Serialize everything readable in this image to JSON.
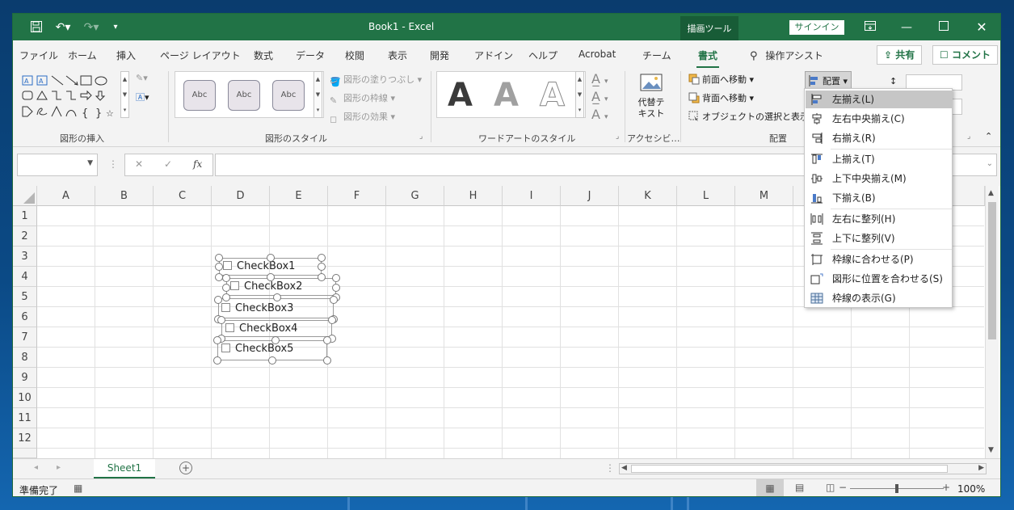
{
  "window": {
    "title": "Book1  -  Excel",
    "context_tool": "描画ツール",
    "signin": "サインイン"
  },
  "tabs": [
    {
      "label": "ファイル"
    },
    {
      "label": "ホーム"
    },
    {
      "label": "挿入"
    },
    {
      "label": "ページ レイアウト"
    },
    {
      "label": "数式"
    },
    {
      "label": "データ"
    },
    {
      "label": "校閲"
    },
    {
      "label": "表示"
    },
    {
      "label": "開発"
    },
    {
      "label": "アドイン"
    },
    {
      "label": "ヘルプ"
    },
    {
      "label": "Acrobat"
    },
    {
      "label": "チーム"
    },
    {
      "label": "書式"
    }
  ],
  "tell_me": "操作アシスト",
  "share_label": "共有",
  "comment_label": "コメント",
  "ribbon": {
    "groups": {
      "insert_shapes": "図形の挿入",
      "shape_styles": "図形のスタイル",
      "wordart_styles": "ワードアートのスタイル",
      "accessibility": "アクセシビ…",
      "arrange": "配置"
    },
    "style_preview_text": "Abc",
    "shape_fill": "図形の塗りつぶし",
    "shape_outline": "図形の枠線",
    "shape_effects": "図形の効果",
    "wordart_letter": "A",
    "alt_text": "代替テキスト",
    "bring_forward": "前面へ移動",
    "send_backward": "背面へ移動",
    "selection_pane": "オブジェクトの選択と表示",
    "align_button": "配置"
  },
  "formula_bar": {
    "name_box": "",
    "fx": "fx",
    "content": ""
  },
  "sheet": {
    "columns": [
      "A",
      "B",
      "C",
      "D",
      "E",
      "F",
      "G",
      "H",
      "I",
      "J",
      "K",
      "L",
      "M",
      "N"
    ],
    "rows": [
      "1",
      "2",
      "3",
      "4",
      "5",
      "6",
      "7",
      "8",
      "9",
      "10",
      "11",
      "12"
    ],
    "checkboxes": [
      "CheckBox1",
      "CheckBox2",
      "CheckBox3",
      "CheckBox4",
      "CheckBox5"
    ]
  },
  "sheet_tabs": [
    {
      "label": "Sheet1"
    }
  ],
  "status": {
    "ready": "準備完了",
    "zoom": "100%"
  },
  "align_menu": {
    "items": [
      {
        "label": "左揃え(L)",
        "icon": "align-left-icon",
        "highlighted": true
      },
      {
        "label": "左右中央揃え(C)",
        "icon": "align-center-icon"
      },
      {
        "label": "右揃え(R)",
        "icon": "align-right-icon"
      },
      {
        "label": "上揃え(T)",
        "icon": "align-top-icon"
      },
      {
        "label": "上下中央揃え(M)",
        "icon": "align-middle-icon"
      },
      {
        "label": "下揃え(B)",
        "icon": "align-bottom-icon"
      },
      {
        "label": "左右に整列(H)",
        "icon": "distribute-horizontal-icon"
      },
      {
        "label": "上下に整列(V)",
        "icon": "distribute-vertical-icon"
      },
      {
        "label": "枠線に合わせる(P)",
        "icon": "snap-to-grid-icon"
      },
      {
        "label": "図形に位置を合わせる(S)",
        "icon": "snap-to-shape-icon"
      },
      {
        "label": "枠線の表示(G)",
        "icon": "view-gridlines-icon"
      }
    ]
  },
  "colors": {
    "excel_green": "#217346",
    "highlight": "#c6c6c6"
  }
}
